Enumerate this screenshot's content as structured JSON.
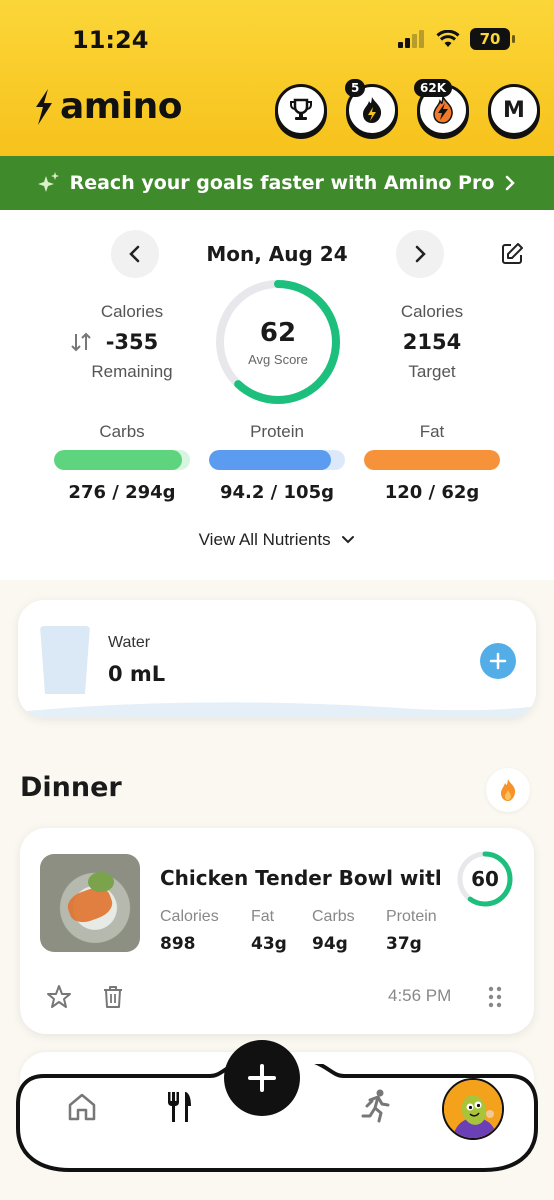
{
  "status": {
    "time": "11:24",
    "battery": "70"
  },
  "header": {
    "app_name": "amino",
    "streak_count": "5",
    "points_count": "62K",
    "profile_initial": "M"
  },
  "promo": {
    "text": "Reach your goals faster with Amino Pro"
  },
  "summary": {
    "date": "Mon, Aug 24",
    "remaining": {
      "label": "Calories",
      "value": "-355",
      "sub": "Remaining"
    },
    "score": {
      "value": "62",
      "label": "Avg Score",
      "fraction": 0.62
    },
    "target": {
      "label": "Calories",
      "value": "2154",
      "sub": "Target"
    },
    "macros": [
      {
        "name": "Carbs",
        "value": "276 / 294g",
        "fraction": 0.94,
        "color": "#5dd47d",
        "track": "#d7f5df"
      },
      {
        "name": "Protein",
        "value": "94.2 / 105g",
        "fraction": 0.9,
        "color": "#5b9cf0",
        "track": "#dce9fb"
      },
      {
        "name": "Fat",
        "value": "120 / 62g",
        "fraction": 1.0,
        "color": "#f6923a",
        "track": "#fde2c9"
      }
    ],
    "view_all": "View All Nutrients"
  },
  "water": {
    "label": "Water",
    "value": "0 mL"
  },
  "meal": {
    "title": "Dinner",
    "item": {
      "name": "Chicken Tender Bowl with...",
      "score": "60",
      "score_fraction": 0.6,
      "calories": {
        "label": "Calories",
        "value": "898"
      },
      "fat": {
        "label": "Fat",
        "value": "43g"
      },
      "carbs": {
        "label": "Carbs",
        "value": "94g"
      },
      "protein": {
        "label": "Protein",
        "value": "37g"
      },
      "time": "4:56 PM"
    }
  },
  "colors": {
    "brand_yellow": "#f7c21c",
    "promo_green": "#3f8a2a",
    "score_green": "#1dbf7c"
  },
  "tabbar": {
    "items": [
      "home-icon",
      "utensils-icon",
      "plus-icon",
      "running-icon",
      "profile-avatar"
    ]
  }
}
